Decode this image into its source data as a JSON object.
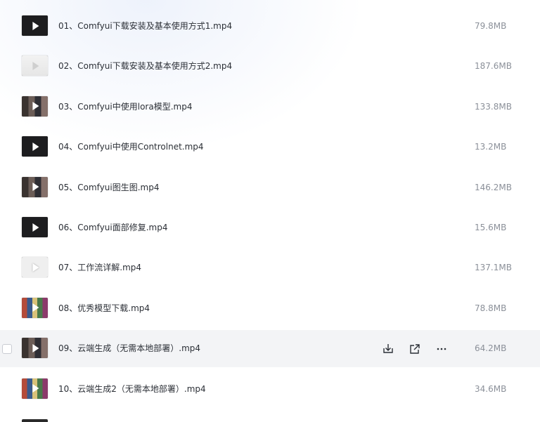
{
  "files": [
    {
      "name": "01、Comfyui下载安装及基本使用方式1.mp4",
      "size": "79.8MB",
      "thumb": "t-dark"
    },
    {
      "name": "02、Comfyui下载安装及基本使用方式2.mp4",
      "size": "187.6MB",
      "thumb": "t-light"
    },
    {
      "name": "03、Comfyui中使用lora模型.mp4",
      "size": "133.8MB",
      "thumb": "t-photo"
    },
    {
      "name": "04、Comfyui中使用Controlnet.mp4",
      "size": "13.2MB",
      "thumb": "t-dark"
    },
    {
      "name": "05、Comfyui图生图.mp4",
      "size": "146.2MB",
      "thumb": "t-photo"
    },
    {
      "name": "06、Comfyui面部修复.mp4",
      "size": "15.6MB",
      "thumb": "t-dark"
    },
    {
      "name": "07、工作流详解.mp4",
      "size": "137.1MB",
      "thumb": "t-white"
    },
    {
      "name": "08、优秀模型下载.mp4",
      "size": "78.8MB",
      "thumb": "t-grid"
    },
    {
      "name": "09、云端生成（无需本地部署）.mp4",
      "size": "64.2MB",
      "thumb": "t-photo",
      "hovered": true
    },
    {
      "name": "10、云端生成2（无需本地部署）.mp4",
      "size": "34.6MB",
      "thumb": "t-grid"
    }
  ],
  "row_actions": {
    "download_icon": "download-icon",
    "share_icon": "share-icon",
    "more_icon": "more-icon"
  }
}
